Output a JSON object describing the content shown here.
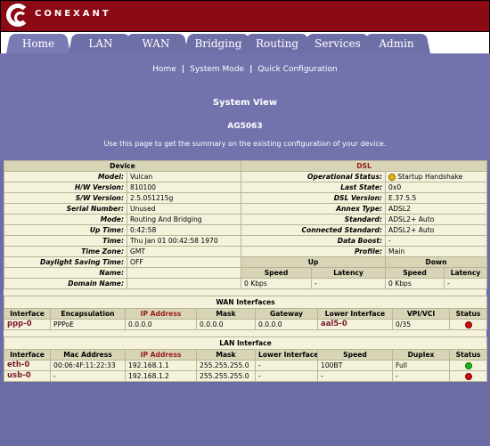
{
  "brand": {
    "logo_text": "CONEXANT"
  },
  "tabs": [
    {
      "label": "Home"
    },
    {
      "label": "LAN"
    },
    {
      "label": "WAN"
    },
    {
      "label": "Bridging"
    },
    {
      "label": "Routing"
    },
    {
      "label": "Services"
    },
    {
      "label": "Admin"
    }
  ],
  "subnav": {
    "links": [
      "Home",
      "System Mode",
      "Quick Configuration"
    ],
    "separator": "|",
    "title": "System View",
    "model_id": "AG5063",
    "description": "Use this page to get the summary on the existing configuration of your device."
  },
  "device": {
    "header": "Device",
    "rows": [
      {
        "label": "Model:",
        "value": "Vulcan"
      },
      {
        "label": "H/W Version:",
        "value": "810100"
      },
      {
        "label": "S/W Version:",
        "value": "2.5.051215g"
      },
      {
        "label": "Serial Number:",
        "value": "Unused"
      },
      {
        "label": "Mode:",
        "value": "Routing And Bridging"
      },
      {
        "label": "Up Time:",
        "value": "0:42:58"
      },
      {
        "label": "Time:",
        "value": "Thu Jan 01 00:42:58 1970"
      },
      {
        "label": "Time Zone:",
        "value": "GMT"
      },
      {
        "label": "Daylight Saving Time:",
        "value": "OFF"
      },
      {
        "label": "Name:",
        "value": ""
      },
      {
        "label": "Domain Name:",
        "value": ""
      }
    ]
  },
  "dsl": {
    "header": "DSL",
    "rows": [
      {
        "label": "Operational Status:",
        "value": "Startup Handshake"
      },
      {
        "label": "Last State:",
        "value": "0x0"
      },
      {
        "label": "DSL Version:",
        "value": "E.37.5.5"
      },
      {
        "label": "Annex Type:",
        "value": "ADSL2"
      },
      {
        "label": "Standard:",
        "value": "ADSL2+ Auto"
      },
      {
        "label": "Connected Standard:",
        "value": "ADSL2+ Auto"
      },
      {
        "label": "Data Boost:",
        "value": "-"
      },
      {
        "label": "Profile:",
        "value": "Main"
      }
    ],
    "up_label": "Up",
    "down_label": "Down",
    "speed_label": "Speed",
    "latency_label": "Latency",
    "up_speed": "0 Kbps",
    "up_latency": "-",
    "down_speed": "0 Kbps",
    "down_latency": "-"
  },
  "wan": {
    "title": "WAN Interfaces",
    "columns": [
      "Interface",
      "Encapsulation",
      "IP Address",
      "Mask",
      "Gateway",
      "Lower Interface",
      "VPI/VCI",
      "Status"
    ],
    "rows": [
      {
        "interface": "ppp-0",
        "encapsulation": "PPPoE",
        "ip": "0.0.0.0",
        "mask": "0.0.0.0",
        "gateway": "0.0.0.0",
        "lower": "aal5-0",
        "vpivci": "0/35",
        "status": "red"
      }
    ]
  },
  "lan": {
    "title": "LAN Interface",
    "columns": [
      "Interface",
      "Mac Address",
      "IP Address",
      "Mask",
      "Lower Interface",
      "Speed",
      "Duplex",
      "Status"
    ],
    "rows": [
      {
        "interface": "eth-0",
        "mac": "00:06:4F:11:22:33",
        "ip": "192.168.1.1",
        "mask": "255.255.255.0",
        "lower": "-",
        "speed": "100BT",
        "duplex": "Full",
        "status": "green"
      },
      {
        "interface": "usb-0",
        "mac": "-",
        "ip": "192.168.1.2",
        "mask": "255.255.255.0",
        "lower": "-",
        "speed": "-",
        "duplex": "-",
        "status": "red"
      }
    ]
  },
  "colors": {
    "header_red": "#8c0a14",
    "nav_purple": "#7272ac",
    "table_bg": "#f5f2dc",
    "status_red": "#d01010",
    "status_green": "#22b022",
    "status_yellow": "#e5b210"
  }
}
